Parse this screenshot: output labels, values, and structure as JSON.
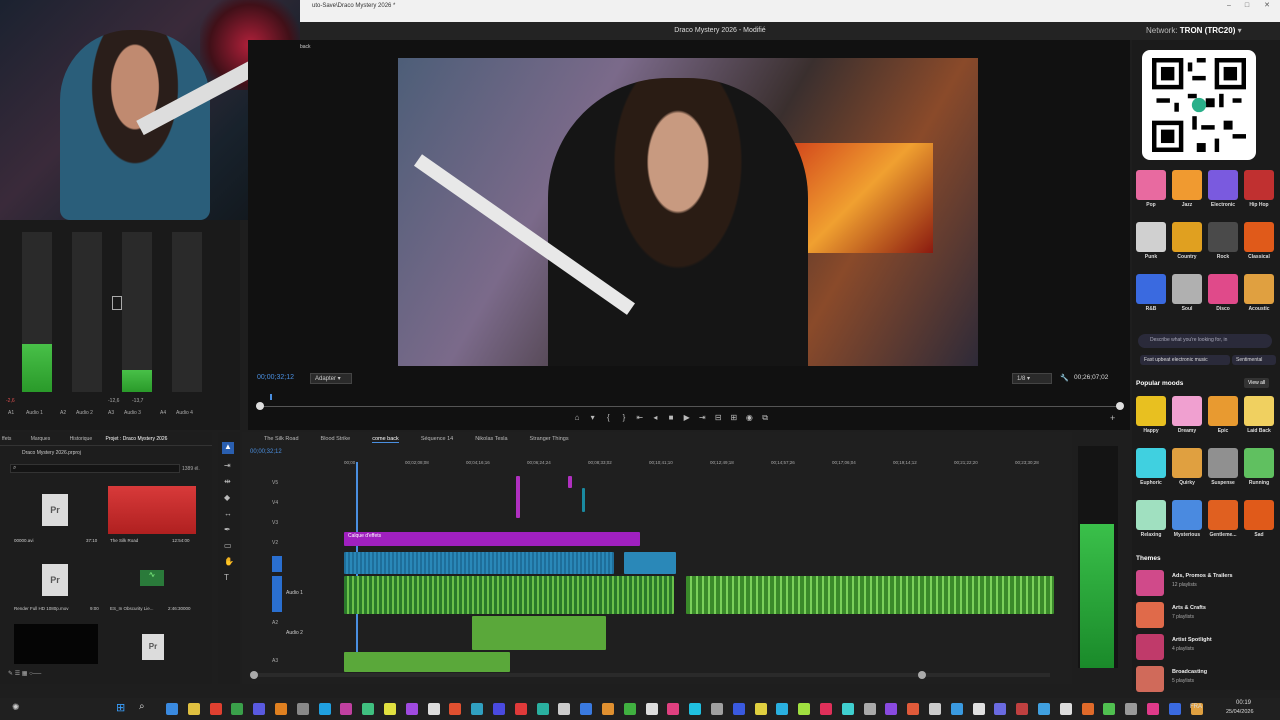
{
  "window": {
    "title_path": "uto-Save\\Draco Mystery 2026 *",
    "app_title": "Draco Mystery 2026 - Modifié"
  },
  "monitor": {
    "tab_fragment": "back",
    "timecode_left": "00;00;32;12",
    "fit": "Adapter",
    "quality": "1/8",
    "timecode_right": "00;26;07;02"
  },
  "meters": {
    "labels": [
      "A1",
      "Audio 1",
      "A2",
      "Audio 2",
      "A3",
      "Audio 3",
      "A4",
      "Audio 4"
    ],
    "values": [
      "-2,6",
      "-12,6",
      "-13,7"
    ]
  },
  "network": {
    "label": "Network:",
    "value": "TRON (TRC20)"
  },
  "moods": {
    "grid": [
      {
        "label": "Pop",
        "color": "#e86aa0"
      },
      {
        "label": "Jazz",
        "color": "#f09a30"
      },
      {
        "label": "Electronic",
        "color": "#7a5adf"
      },
      {
        "label": "Hip Hop",
        "color": "#c03030"
      },
      {
        "label": "Punk",
        "color": "#d0d0d0"
      },
      {
        "label": "Country",
        "color": "#e0a020"
      },
      {
        "label": "Rock",
        "color": "#4a4a4a"
      },
      {
        "label": "Classical",
        "color": "#e05a1a"
      },
      {
        "label": "R&B",
        "color": "#3a6ae0"
      },
      {
        "label": "Soul",
        "color": "#b0b0b0"
      },
      {
        "label": "Disco",
        "color": "#e04a8a"
      },
      {
        "label": "Acoustic",
        "color": "#e0a040"
      }
    ],
    "search_placeholder": "Describe what you're looking for, in",
    "chips": [
      "Fast upbeat electronic music",
      "Sentimental"
    ],
    "popular_title": "Popular moods",
    "view_all": "View all",
    "popular": [
      {
        "label": "Happy",
        "color": "#e8c020"
      },
      {
        "label": "Dreamy",
        "color": "#f0a0d0"
      },
      {
        "label": "Epic",
        "color": "#e89a30"
      },
      {
        "label": "Laid Back",
        "color": "#f0d060"
      },
      {
        "label": "Euphoric",
        "color": "#40d0e0"
      },
      {
        "label": "Quirky",
        "color": "#e0a040"
      },
      {
        "label": "Suspense",
        "color": "#909090"
      },
      {
        "label": "Running",
        "color": "#60c060"
      },
      {
        "label": "Relaxing",
        "color": "#a0e0c0"
      },
      {
        "label": "Mysterious",
        "color": "#4a8ae0"
      },
      {
        "label": "Gentleme...",
        "color": "#e06020"
      },
      {
        "label": "Sad",
        "color": "#e05a1a"
      }
    ],
    "themes_title": "Themes",
    "themes": [
      {
        "title": "Ads, Promos & Trailers",
        "sub": "12 playlists",
        "color": "#d04a8a"
      },
      {
        "title": "Arts & Crafts",
        "sub": "7 playlists",
        "color": "#e06a4a"
      },
      {
        "title": "Artist Spotlight",
        "sub": "4 playlists",
        "color": "#c03a6a"
      },
      {
        "title": "Broadcasting",
        "sub": "5 playlists",
        "color": "#d06a5a"
      }
    ]
  },
  "project_panel": {
    "tabs": [
      "ffets",
      "Marques",
      "Historique",
      "Projet : Draco Mystery 2026"
    ],
    "project_file": "Draco Mystery 2026.prproj",
    "item_count": "1389 él.",
    "items": [
      {
        "name": "00000.avi",
        "duration": "37:10"
      },
      {
        "name": "The Silk Road",
        "duration": "12:54:00"
      },
      {
        "name": "Render Full HD 1080p.mov",
        "duration": "9:00"
      },
      {
        "name": "ES_In Obscurity Lie...",
        "duration": "2:46:30000"
      }
    ]
  },
  "timeline": {
    "tabs": [
      "The Silk Road",
      "Blood Strike",
      "come back",
      "Séquence 14",
      "Nikolas Tesla",
      "Stranger Things"
    ],
    "active_tab": "come back",
    "timecode": "00;00;32;12",
    "ruler": [
      "00;00",
      "00;02;08;08",
      "00;04;16;16",
      "00;06;24;24",
      "00;08;33;02",
      "00;10;41;10",
      "00;12;49;18",
      "00;14;57;26",
      "00;17;06;04",
      "00;19;14;12",
      "00;21;22;20",
      "00;23;30;28"
    ],
    "tracks": [
      "V5",
      "V4",
      "V3",
      "V2",
      "V1",
      "A1",
      "A2",
      "A3"
    ],
    "track_names": {
      "a1": "Audio 1",
      "a2": "Audio 2"
    },
    "effects_clip": "Calque d'effets"
  },
  "taskbar": {
    "lang": "FRA",
    "time": "00:19",
    "date": "25/04/2026"
  }
}
